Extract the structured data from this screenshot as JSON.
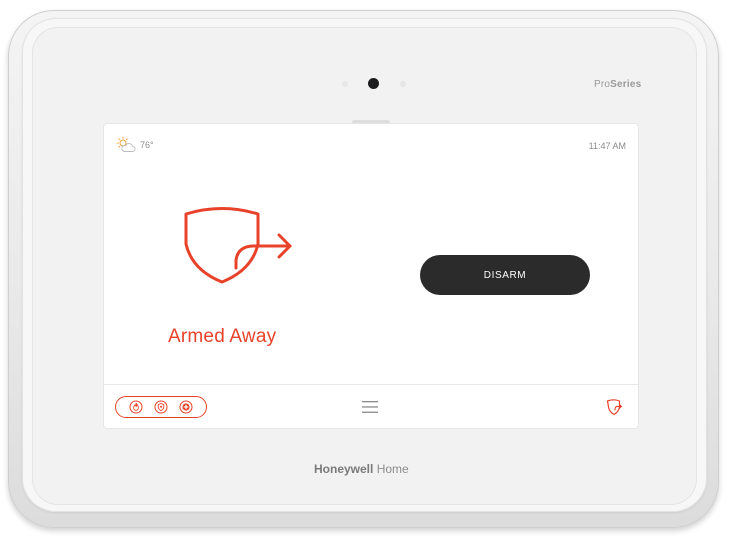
{
  "device": {
    "model_badge": {
      "prefix": "Pro",
      "suffix": "Series"
    },
    "footer_brand": {
      "bold": "Honeywell",
      "regular": " Home"
    }
  },
  "status_bar": {
    "temperature": "76°",
    "time": "11:47 AM",
    "weather_icon": "partly-sunny-icon"
  },
  "main": {
    "status_label": "Armed Away",
    "status_icon": "shield-arrow-icon",
    "status_color": "#e8432a",
    "disarm_label": "DISARM"
  },
  "bottom_bar": {
    "emergency_icons": [
      "fire-icon",
      "police-icon",
      "medical-icon"
    ],
    "menu_icon": "hamburger-menu-icon",
    "security_icon": "shield-arrow-small-icon"
  },
  "colors": {
    "accent": "#e8432a",
    "button_bg": "#2b2b2b",
    "button_text": "#ffffff"
  }
}
